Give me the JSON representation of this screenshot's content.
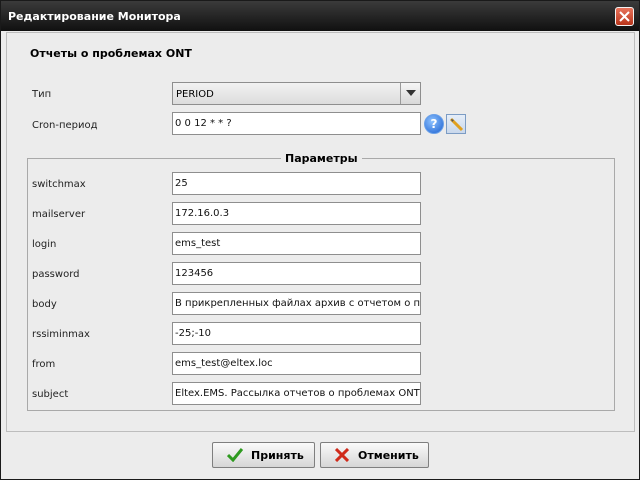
{
  "window": {
    "title": "Редактирование Монитора"
  },
  "main": {
    "section_title": "Отчеты о проблемах ONT",
    "type_label": "Тип",
    "type_value": "PERIOD",
    "cron_label": "Cron-период",
    "cron_value": "0 0 12 * * ?"
  },
  "params": {
    "legend": "Параметры",
    "rows": [
      {
        "label": "switchmax",
        "value": "25"
      },
      {
        "label": "mailserver",
        "value": "172.16.0.3"
      },
      {
        "label": "login",
        "value": "ems_test"
      },
      {
        "label": "password",
        "value": "123456"
      },
      {
        "label": "body",
        "value": "В прикрепленных файлах архив с отчетом о проблемах ONT"
      },
      {
        "label": "rssiminmax",
        "value": "-25;-10"
      },
      {
        "label": "from",
        "value": "ems_test@eltex.loc"
      },
      {
        "label": "subject",
        "value": "Eltex.EMS. Рассылка отчетов о проблемах ONT"
      }
    ]
  },
  "buttons": {
    "ok_label": "Принять",
    "cancel_label": "Отменить"
  },
  "icons": {
    "close": "close-icon",
    "help": "help-icon",
    "edit": "pencil-icon",
    "dropdown": "chevron-down-icon",
    "ok": "checkmark-icon",
    "cancel": "cross-icon"
  },
  "colors": {
    "titlebar": "#1e1e1e",
    "close_button": "#d14a2c",
    "ok_icon": "#2e9a1f",
    "cancel_icon": "#d02a1a"
  }
}
